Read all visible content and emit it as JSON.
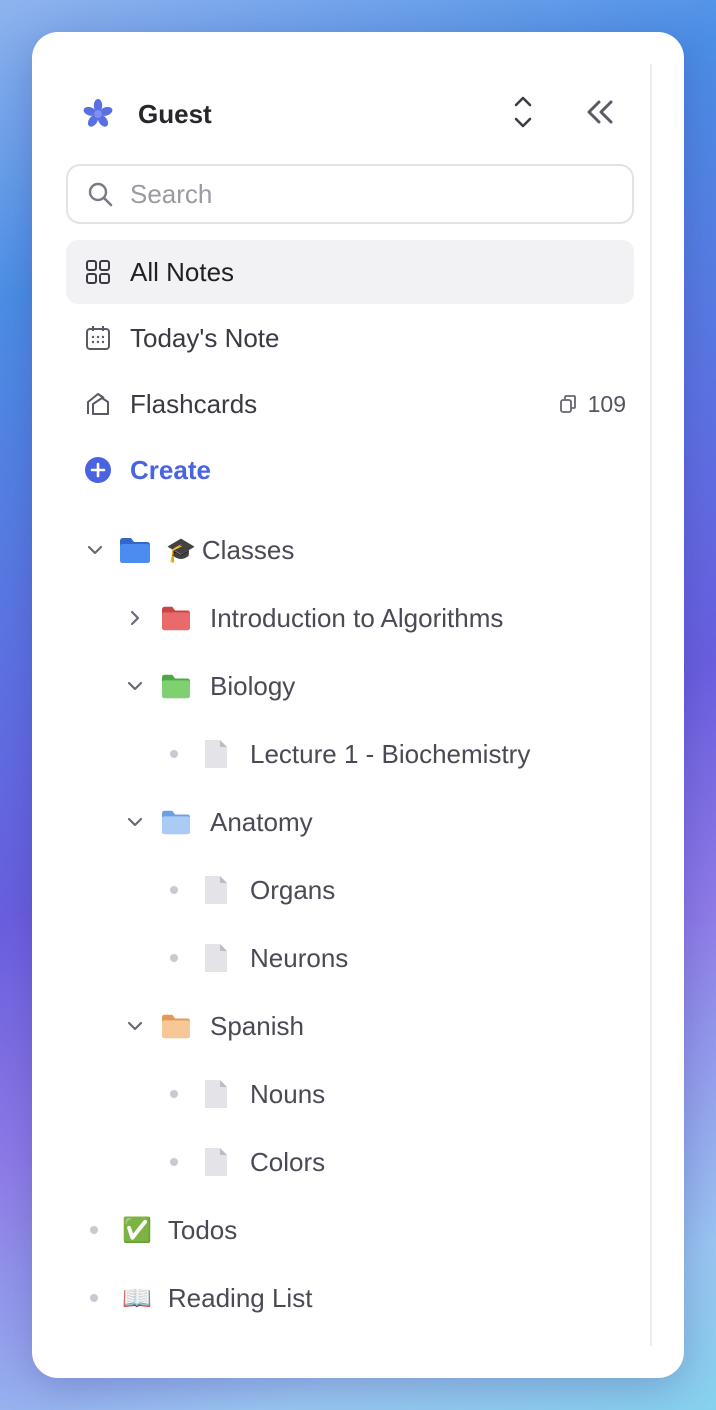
{
  "workspace": {
    "name": "Guest"
  },
  "search": {
    "placeholder": "Search"
  },
  "nav": {
    "all_notes": "All Notes",
    "todays_note": "Today's Note",
    "flashcards": "Flashcards",
    "flashcards_count": "109",
    "create": "Create"
  },
  "tree": {
    "classes": {
      "emoji": "🎓",
      "label": "Classes"
    },
    "intro_algorithms": {
      "label": "Introduction to Algorithms"
    },
    "biology": {
      "label": "Biology"
    },
    "lecture_1": {
      "label": "Lecture 1 - Biochemistry"
    },
    "anatomy": {
      "label": "Anatomy"
    },
    "organs": {
      "label": "Organs"
    },
    "neurons": {
      "label": "Neurons"
    },
    "spanish": {
      "label": "Spanish"
    },
    "nouns": {
      "label": "Nouns"
    },
    "colors": {
      "label": "Colors"
    },
    "todos": {
      "emoji": "✅",
      "label": "Todos"
    },
    "reading_list": {
      "emoji": "📖",
      "label": "Reading List"
    }
  },
  "colors": {
    "accent": "#4a63e0",
    "folder_classes": "#3d7de8",
    "folder_algorithms": "#e05a5a",
    "folder_biology": "#6cc460",
    "folder_anatomy": "#8fb9ee",
    "folder_spanish": "#f0b67a"
  },
  "icons": {
    "workspace": "asterisk-icon",
    "switcher": "chevron-up-down-icon",
    "collapse": "double-chevron-left-icon",
    "search": "search-icon",
    "all_notes": "grid-icon",
    "todays_note": "calendar-icon",
    "flashcards": "flashcard-icon",
    "create": "plus-circle-icon"
  }
}
